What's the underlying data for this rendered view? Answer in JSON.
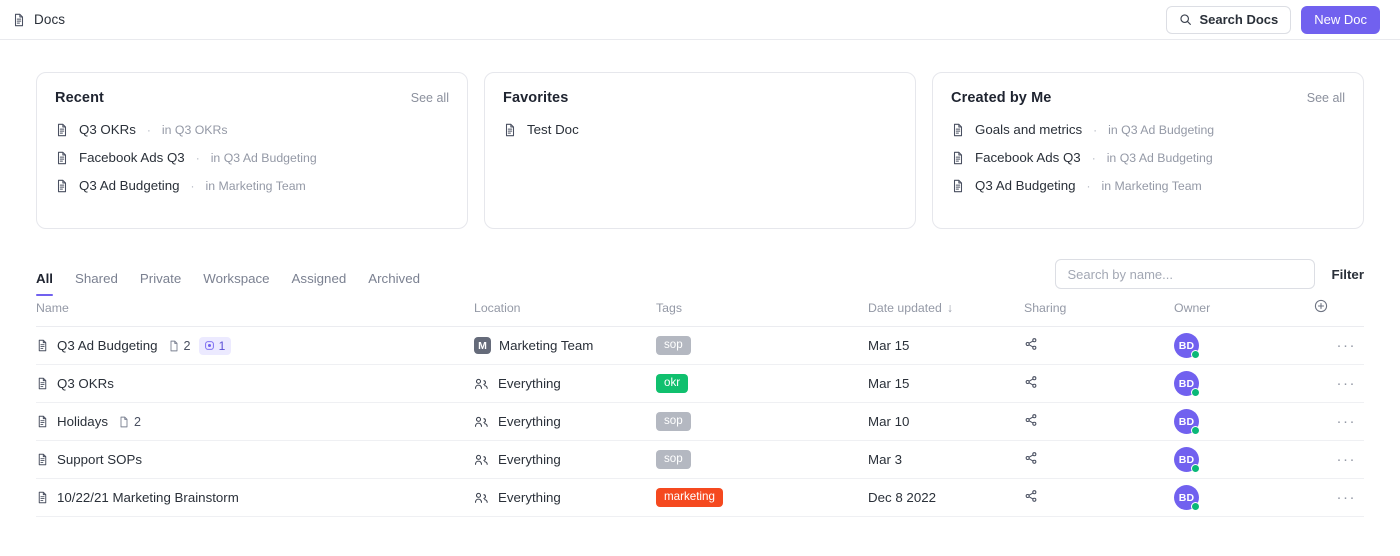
{
  "topbar": {
    "title": "Docs",
    "doc_icon": "document-icon",
    "search_label": "Search Docs",
    "search_icon": "search-icon",
    "new_doc_label": "New Doc"
  },
  "accent_colors": {
    "brand_purple": "#7161ef",
    "tag_gray": "#b4b8c1",
    "tag_green": "#10c06e",
    "tag_orange": "#f5491f",
    "status_green": "#0ab878",
    "badge_bg": "#eceaff"
  },
  "cards": [
    {
      "title": "Recent",
      "see_all": "See all",
      "items": [
        {
          "name": "Q3 OKRs",
          "location": "in Q3 OKRs"
        },
        {
          "name": "Facebook Ads Q3",
          "location": "in Q3 Ad Budgeting"
        },
        {
          "name": "Q3 Ad Budgeting",
          "location": "in Marketing Team"
        }
      ]
    },
    {
      "title": "Favorites",
      "see_all": "",
      "items": [
        {
          "name": "Test Doc",
          "location": ""
        }
      ]
    },
    {
      "title": "Created by Me",
      "see_all": "See all",
      "items": [
        {
          "name": "Goals and metrics",
          "location": "in Q3 Ad Budgeting"
        },
        {
          "name": "Facebook Ads Q3",
          "location": "in Q3 Ad Budgeting"
        },
        {
          "name": "Q3 Ad Budgeting",
          "location": "in Marketing Team"
        }
      ]
    }
  ],
  "tabs": [
    {
      "label": "All",
      "active": true
    },
    {
      "label": "Shared",
      "active": false
    },
    {
      "label": "Private",
      "active": false
    },
    {
      "label": "Workspace",
      "active": false
    },
    {
      "label": "Assigned",
      "active": false
    },
    {
      "label": "Archived",
      "active": false
    }
  ],
  "toolbar": {
    "search_placeholder": "Search by name...",
    "search_value": "",
    "filter_label": "Filter"
  },
  "table": {
    "columns": {
      "name": "Name",
      "location": "Location",
      "tags": "Tags",
      "date_updated": "Date updated",
      "sort_arrow": "↓",
      "sharing": "Sharing",
      "owner": "Owner",
      "add_column_icon": "plus-circle-icon"
    },
    "rows": [
      {
        "name": "Q3 Ad Budgeting",
        "subdoc_count": "2",
        "badge_count": "1",
        "location": "Marketing Team",
        "location_avatar": "M",
        "location_type": "space",
        "tag": "sop",
        "tag_color": "#b4b8c1",
        "date_updated": "Mar 15",
        "sharing_icon": "share-icon",
        "owner_initials": "BD",
        "more_label": "···"
      },
      {
        "name": "Q3 OKRs",
        "subdoc_count": "",
        "badge_count": "",
        "location": "Everything",
        "location_avatar": "",
        "location_type": "everything",
        "tag": "okr",
        "tag_color": "#10c06e",
        "date_updated": "Mar 15",
        "sharing_icon": "share-icon",
        "owner_initials": "BD",
        "more_label": "···"
      },
      {
        "name": "Holidays",
        "subdoc_count": "2",
        "badge_count": "",
        "location": "Everything",
        "location_avatar": "",
        "location_type": "everything",
        "tag": "sop",
        "tag_color": "#b4b8c1",
        "date_updated": "Mar 10",
        "sharing_icon": "share-icon",
        "owner_initials": "BD",
        "more_label": "···"
      },
      {
        "name": "Support SOPs",
        "subdoc_count": "",
        "badge_count": "",
        "location": "Everything",
        "location_avatar": "",
        "location_type": "everything",
        "tag": "sop",
        "tag_color": "#b4b8c1",
        "date_updated": "Mar 3",
        "sharing_icon": "share-icon",
        "owner_initials": "BD",
        "more_label": "···"
      },
      {
        "name": "10/22/21 Marketing Brainstorm",
        "subdoc_count": "",
        "badge_count": "",
        "location": "Everything",
        "location_avatar": "",
        "location_type": "everything",
        "tag": "marketing",
        "tag_color": "#f5491f",
        "date_updated": "Dec 8 2022",
        "sharing_icon": "share-icon",
        "owner_initials": "BD",
        "more_label": "···"
      }
    ]
  }
}
